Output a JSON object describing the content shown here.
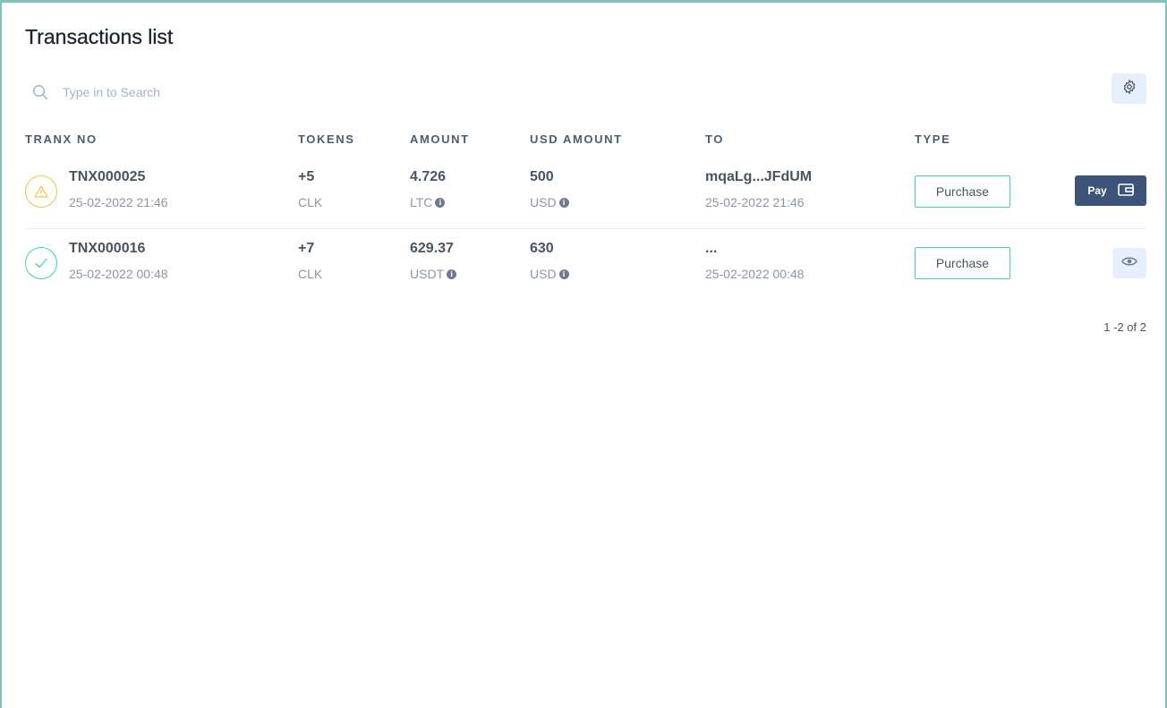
{
  "page": {
    "title": "Transactions list"
  },
  "search": {
    "placeholder": "Type in to Search",
    "icon": "search-icon"
  },
  "settings": {
    "icon": "gear-icon"
  },
  "table": {
    "headers": {
      "tranx_no": "TRANX NO",
      "tokens": "TOKENS",
      "amount": "AMOUNT",
      "usd_amount": "USD AMOUNT",
      "to": "TO",
      "type": "TYPE"
    },
    "rows": [
      {
        "status": "pending",
        "status_icon": "warning-icon",
        "status_color": "#f6c244",
        "tranx_no": "TNX000025",
        "date": "25-02-2022 21:46",
        "tokens": "+5",
        "token_symbol": "CLK",
        "amount": "4.726",
        "amount_currency": "LTC",
        "usd_amount": "500",
        "usd_currency": "USD",
        "to": "mqaLg...JFdUM",
        "to_date": "25-02-2022 21:46",
        "type": "Purchase",
        "action_label": "Pay",
        "action_icon": "wallet-icon"
      },
      {
        "status": "approved",
        "status_icon": "check-icon",
        "status_color": "#3fd2b7",
        "tranx_no": "TNX000016",
        "date": "25-02-2022 00:48",
        "tokens": "+7",
        "token_symbol": "CLK",
        "amount": "629.37",
        "amount_currency": "USDT",
        "usd_amount": "630",
        "usd_currency": "USD",
        "to": "...",
        "to_date": "25-02-2022 00:48",
        "type": "Purchase",
        "action_icon": "eye-icon"
      }
    ]
  },
  "pagination": {
    "text": "1 -2 of 2"
  },
  "colors": {
    "accent": "#3fd2b7",
    "primary": "#3d5478",
    "frame": "#7fc4bb"
  }
}
